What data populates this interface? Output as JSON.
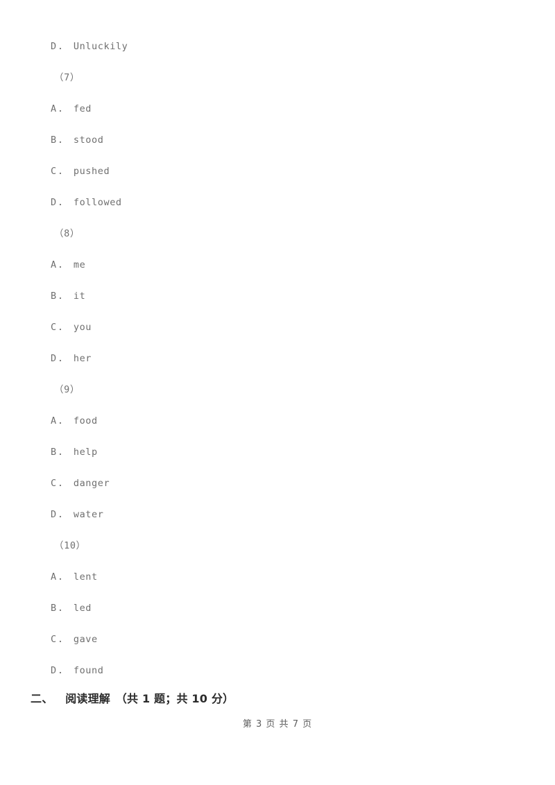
{
  "document": {
    "page_footer": "第 3 页 共 7 页",
    "blocks": [
      {
        "kind": "option",
        "letter": "D",
        "separator": "．",
        "text": "Unluckily"
      },
      {
        "kind": "stem",
        "label": "（7）"
      },
      {
        "kind": "option",
        "letter": "A",
        "separator": "．",
        "text": "fed"
      },
      {
        "kind": "option",
        "letter": "B",
        "separator": "．",
        "text": "stood"
      },
      {
        "kind": "option",
        "letter": "C",
        "separator": "．",
        "text": "pushed"
      },
      {
        "kind": "option",
        "letter": "D",
        "separator": "．",
        "text": "followed"
      },
      {
        "kind": "stem",
        "label": "（8）"
      },
      {
        "kind": "option",
        "letter": "A",
        "separator": "．",
        "text": "me"
      },
      {
        "kind": "option",
        "letter": "B",
        "separator": "．",
        "text": "it"
      },
      {
        "kind": "option",
        "letter": "C",
        "separator": "．",
        "text": "you"
      },
      {
        "kind": "option",
        "letter": "D",
        "separator": "．",
        "text": "her"
      },
      {
        "kind": "stem",
        "label": "（9）"
      },
      {
        "kind": "option",
        "letter": "A",
        "separator": "．",
        "text": "food"
      },
      {
        "kind": "option",
        "letter": "B",
        "separator": "．",
        "text": "help"
      },
      {
        "kind": "option",
        "letter": "C",
        "separator": "．",
        "text": "danger"
      },
      {
        "kind": "option",
        "letter": "D",
        "separator": "．",
        "text": "water"
      },
      {
        "kind": "stem",
        "label": "（10）"
      },
      {
        "kind": "option",
        "letter": "A",
        "separator": "．",
        "text": "lent"
      },
      {
        "kind": "option",
        "letter": "B",
        "separator": "．",
        "text": "led"
      },
      {
        "kind": "option",
        "letter": "C",
        "separator": "．",
        "text": "gave"
      },
      {
        "kind": "option",
        "letter": "D",
        "separator": "．",
        "text": "found"
      }
    ],
    "section_heading": {
      "number": "二、",
      "title": "阅读理解",
      "meta": "（共 1 题；共 10 分）"
    }
  }
}
